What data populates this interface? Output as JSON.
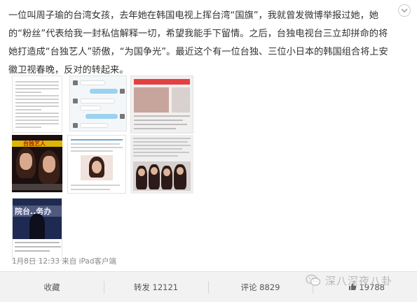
{
  "post": {
    "text": "一位叫周子瑜的台湾女孩，去年她在韩国电视上挥台湾“国旗”，我就曾发微博举报过她，她的“粉丝”代表给我一封私信解释一切，希望我能手下留情。之后，台独电视台三立却拼命的将她打造成“台独艺人”骄傲，“为国争光”。最近这个有一位台独、三位小日本的韩国组合将上安徽卫视春晚，反对的转起来。",
    "timestamp": "1月8日 12:33 来自 iPad客户端"
  },
  "thumbnails": [
    {
      "name": "article-screenshot"
    },
    {
      "name": "chat-screenshot"
    },
    {
      "name": "tv-screenshot"
    },
    {
      "name": "tv-show-photo"
    },
    {
      "name": "news-screenshot"
    },
    {
      "name": "group-photo-screenshot"
    },
    {
      "name": "press-conference-screenshot"
    }
  ],
  "thumb_text": {
    "t4_caption": "台独艺人",
    "t7_banner": "院台..务办"
  },
  "actions": {
    "favorite": "收藏",
    "repost": "转发 12121",
    "comment": "评论 8829",
    "like": "19788"
  },
  "watermark": {
    "text": "深八深夜八卦"
  },
  "colors": {
    "background": "#ffffff",
    "action_bar": "#f2f2f2",
    "text": "#333333",
    "meta": "#888888"
  },
  "icons": {
    "menu": "chevron-down-icon",
    "like": "thumbs-up-icon",
    "watermark": "wechat-icon"
  }
}
